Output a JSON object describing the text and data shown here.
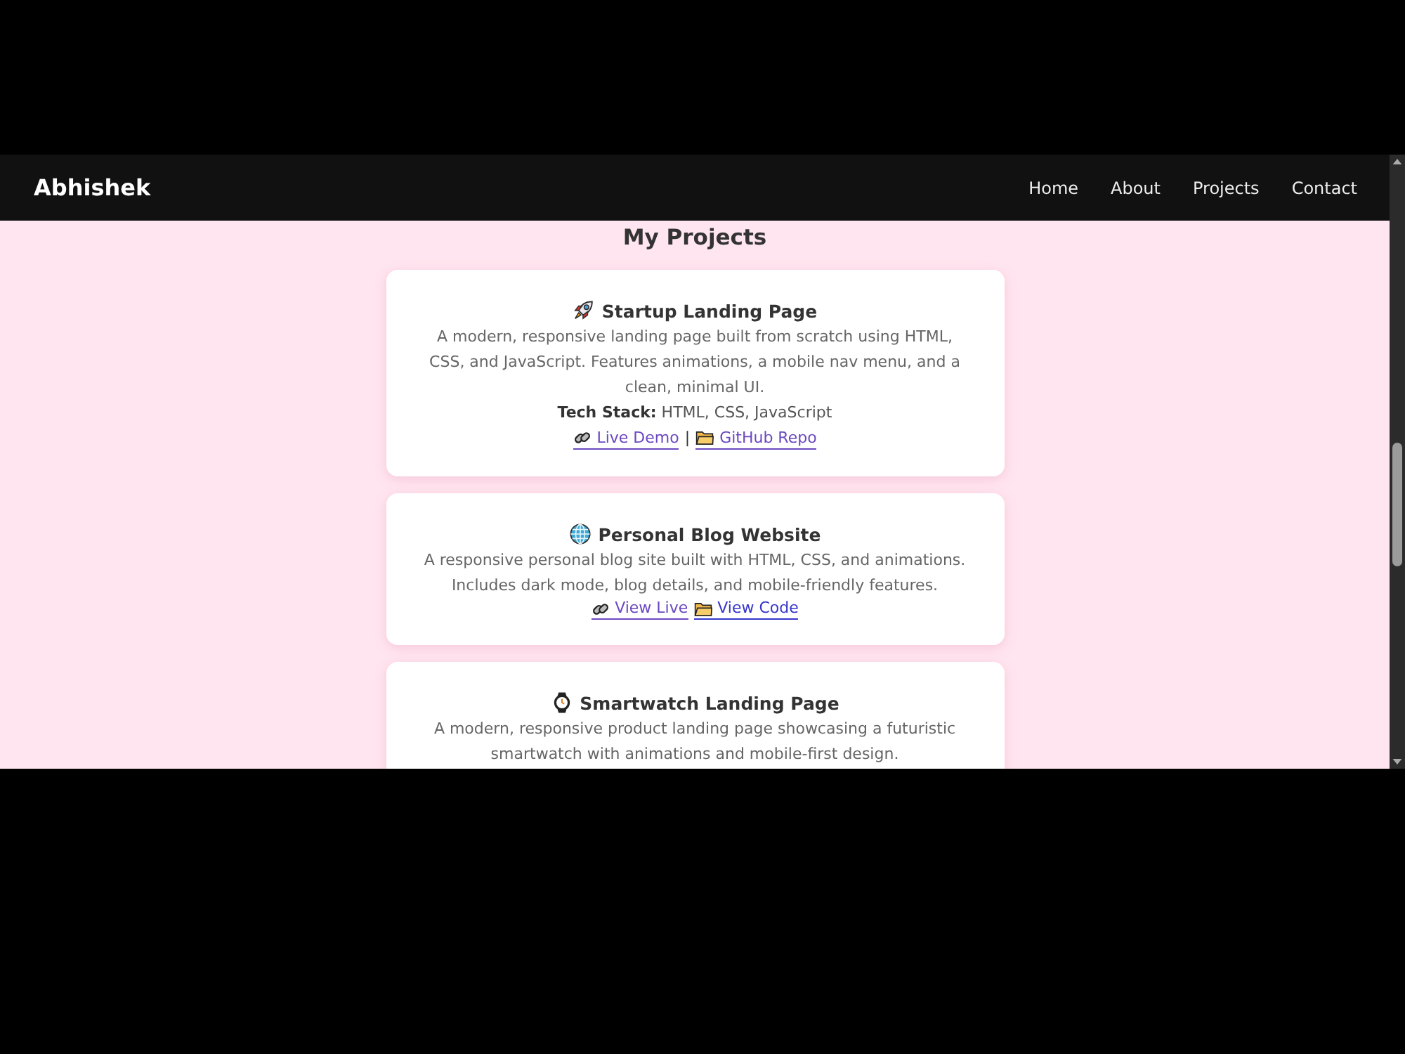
{
  "navbar": {
    "logo": "Abhishek",
    "links": [
      "Home",
      "About",
      "Projects",
      "Contact"
    ]
  },
  "heading": "My Projects",
  "projects": [
    {
      "kind": "rocket",
      "title": "Startup Landing Page",
      "description": "A modern, responsive landing page built from scratch using HTML, CSS, and JavaScript. Features animations, a mobile nav menu, and a clean, minimal UI.",
      "tech_stack": "**Tech Stack:** HTML, CSS, JavaScript",
      "separator": "|",
      "links": [
        {
          "kind": "demo",
          "label": "Live Demo",
          "visited": true
        },
        {
          "kind": "code",
          "label": "GitHub Repo",
          "visited": true
        }
      ]
    },
    {
      "kind": "globe",
      "title": "Personal Blog Website",
      "description": "A responsive personal blog site built with HTML, CSS, and animations. Includes dark mode, blog details, and mobile-friendly features.",
      "links": [
        {
          "kind": "demo",
          "label": "View Live",
          "visited": true
        },
        {
          "kind": "code",
          "label": "View Code",
          "visited": false
        }
      ]
    },
    {
      "kind": "watch",
      "title": "Smartwatch Landing Page",
      "description": "A modern, responsive product landing page showcasing a futuristic smartwatch with animations and mobile-first design."
    }
  ]
}
